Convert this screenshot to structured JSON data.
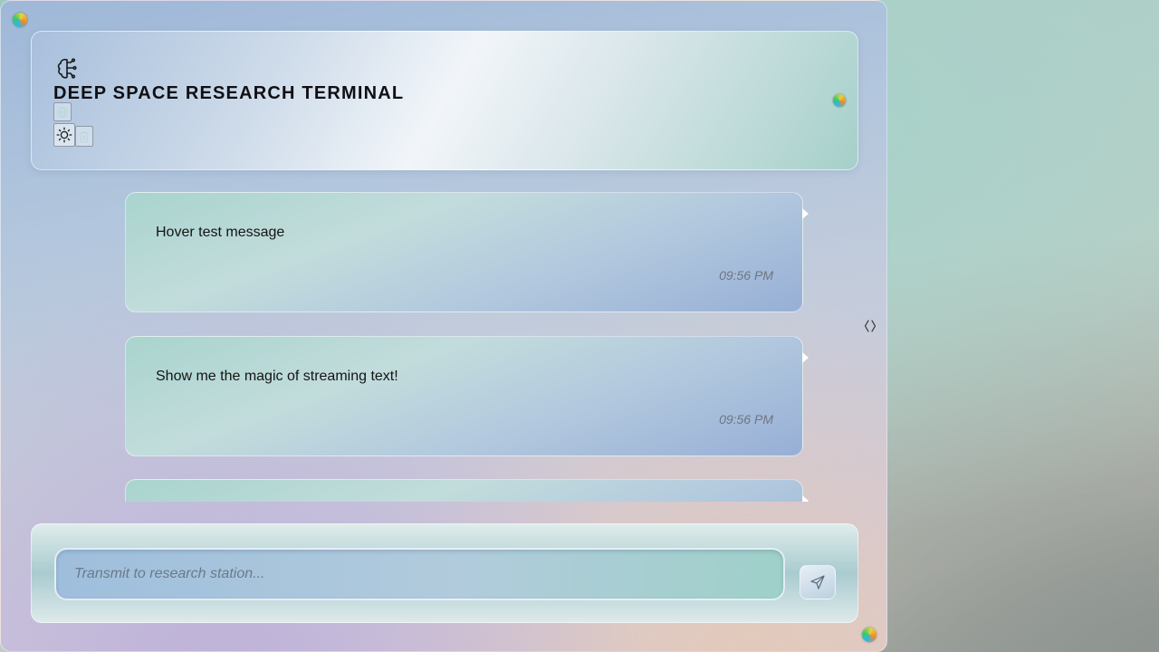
{
  "header": {
    "title": "DEEP SPACE RESEARCH TERMINAL",
    "icons": [
      "brain-icon",
      "globe-icon",
      "sun-icon",
      "trash-icon",
      "code-icon",
      "send-icon"
    ]
  },
  "messages": [
    {
      "text": "Hover test message",
      "time": "09:56 PM"
    },
    {
      "text": "Show me the magic of streaming text!",
      "time": "09:56 PM"
    },
    {
      "text": "",
      "time": ""
    }
  ],
  "composer": {
    "placeholder": "Transmit to research station..."
  }
}
